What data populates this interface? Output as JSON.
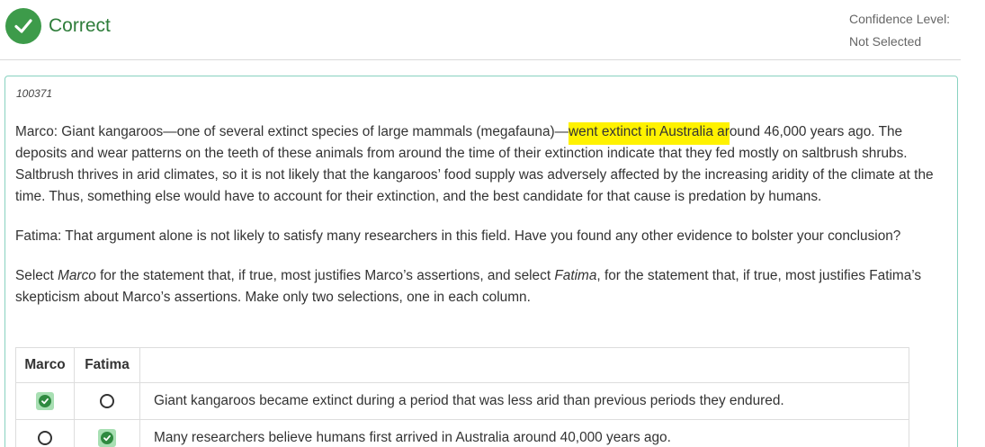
{
  "header": {
    "result_label": "Correct",
    "confidence_label": "Confidence Level:",
    "confidence_value": "Not Selected"
  },
  "question": {
    "id": "100371",
    "marco_before": "Marco: Giant kangaroos—one of several extinct species of large mammals (megafauna)—",
    "marco_highlight": "went extinct in Australia ar",
    "marco_after": "ound 46,000 years ago. The deposits and wear patterns on the teeth of these animals from around the time of their extinction indicate that they fed mostly on saltbrush shrubs. Saltbrush thrives in arid climates, so it is not likely that the kangaroos’ food supply was adversely affected by the increasing aridity of the climate at the time. Thus, something else would have to account for their extinction, and the best candidate for that cause is predation by humans.",
    "fatima": "Fatima: That argument alone is not likely to satisfy many researchers in this field. Have you found any other evidence to bolster your conclusion?",
    "instr_1": "Select ",
    "instr_marco": "Marco",
    "instr_2": " for the statement that, if true, most justifies Marco’s assertions, and select ",
    "instr_fatima": "Fatima",
    "instr_3": ", for the statement that, if true, most justifies Fatima’s skepticism about Marco’s assertions. Make only two selections, one in each column."
  },
  "table": {
    "col_marco": "Marco",
    "col_fatima": "Fatima",
    "rows": [
      {
        "statement": "Giant kangaroos became extinct during a period that was less arid than previous periods they endured.",
        "marco_selected": true,
        "fatima_selected": false
      },
      {
        "statement": "Many researchers believe humans first arrived in Australia around 40,000 years ago.",
        "marco_selected": false,
        "fatima_selected": true
      }
    ]
  },
  "colors": {
    "correct_green": "#3d9b4a",
    "highlight": "#fff200",
    "panel_border": "#88d2c0",
    "selected_check": "#2f8a40"
  }
}
